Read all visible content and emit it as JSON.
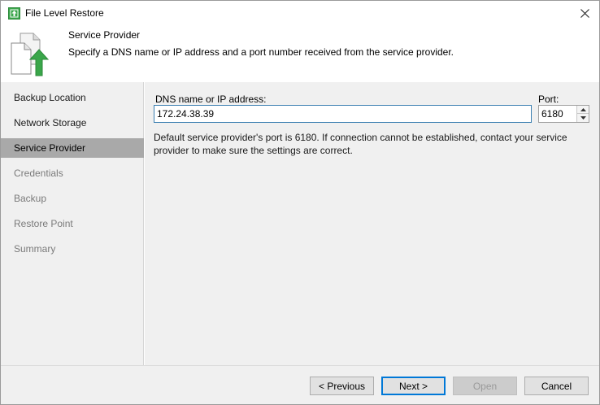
{
  "window": {
    "title": "File Level Restore"
  },
  "header": {
    "title": "Service Provider",
    "description": "Specify a DNS name or IP address and a port number received from the service provider."
  },
  "sidebar": {
    "steps": [
      {
        "label": "Backup Location",
        "state": "done"
      },
      {
        "label": "Network Storage",
        "state": "done"
      },
      {
        "label": "Service Provider",
        "state": "active"
      },
      {
        "label": "Credentials",
        "state": "pending"
      },
      {
        "label": "Backup",
        "state": "pending"
      },
      {
        "label": "Restore Point",
        "state": "pending"
      },
      {
        "label": "Summary",
        "state": "pending"
      }
    ]
  },
  "form": {
    "dns_label": "DNS name or IP address:",
    "dns_value": "172.24.38.39",
    "port_label": "Port:",
    "port_value": "6180",
    "note": "Default service provider's port is 6180. If connection cannot be established, contact your service provider to make sure the settings are correct."
  },
  "footer": {
    "previous_label": "< Previous",
    "next_label": "Next >",
    "open_label": "Open",
    "cancel_label": "Cancel"
  },
  "colors": {
    "accent": "#0078d7",
    "brand_green": "#3aa64a",
    "active_step_bg": "#a9a9a9"
  }
}
